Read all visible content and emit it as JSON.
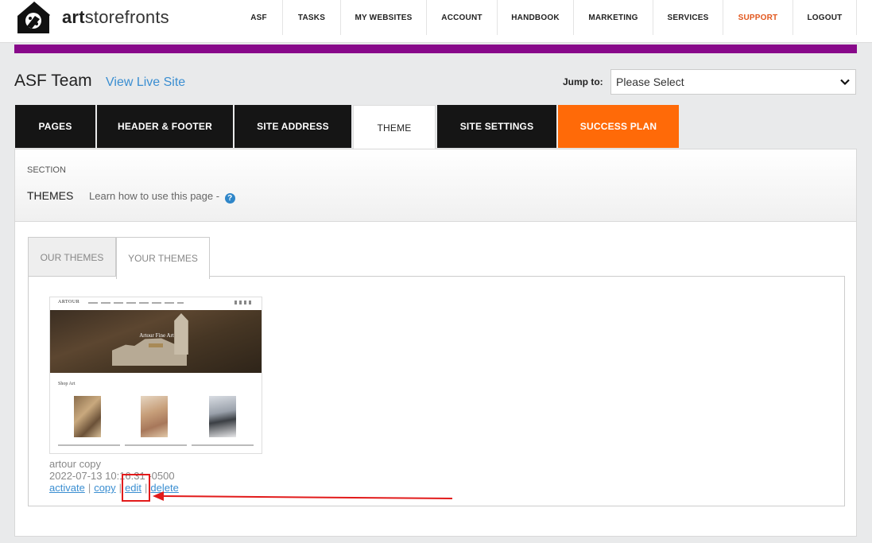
{
  "brand": {
    "logo_prefix": "art",
    "logo_suffix": "storefronts"
  },
  "nav": [
    {
      "label": "ASF",
      "width": 60
    },
    {
      "label": "TASKS",
      "width": 73
    },
    {
      "label": "MY WEBSITES",
      "width": 108
    },
    {
      "label": "ACCOUNT",
      "width": 89
    },
    {
      "label": "HANDBOOK",
      "width": 96
    },
    {
      "label": "MARKETING",
      "width": 100
    },
    {
      "label": "SERVICES",
      "width": 88
    },
    {
      "label": "SUPPORT",
      "width": 88
    },
    {
      "label": "LOGOUT",
      "width": 80
    }
  ],
  "header": {
    "site_title": "ASF Team",
    "view_live_label": "View Live Site",
    "jump_label": "Jump to:",
    "jump_value": "Please Select"
  },
  "tabs": [
    {
      "label": "PAGES",
      "width": 101
    },
    {
      "label": "HEADER & FOOTER",
      "width": 171
    },
    {
      "label": "SITE ADDRESS",
      "width": 147
    },
    {
      "label": "THEME",
      "width": 104
    },
    {
      "label": "SITE SETTINGS",
      "width": 150
    },
    {
      "label": "SUCCESS PLAN",
      "width": 152
    }
  ],
  "section": {
    "section_label": "SECTION",
    "title": "THEMES",
    "learn_text": "Learn how to use this page -",
    "help_glyph": "?"
  },
  "subtabs": {
    "our": "OUR THEMES",
    "yours": "YOUR THEMES"
  },
  "theme": {
    "thumb_logo": "ARTOUR",
    "thumb_hero_title": "Artour Fine Art",
    "thumb_section": "Shop Art",
    "name": "artour copy",
    "date": "2022-07-13 10:16:31 -0500",
    "actions": {
      "activate": "activate",
      "copy": "copy",
      "edit": "edit",
      "delete": "delete",
      "separator": "|"
    }
  },
  "colors": {
    "accent_purple": "#88098a",
    "success_orange": "#ff6a08",
    "link_blue": "#3a8ed1",
    "support_red": "#e2561c",
    "annotation_red": "#e21b1b"
  }
}
